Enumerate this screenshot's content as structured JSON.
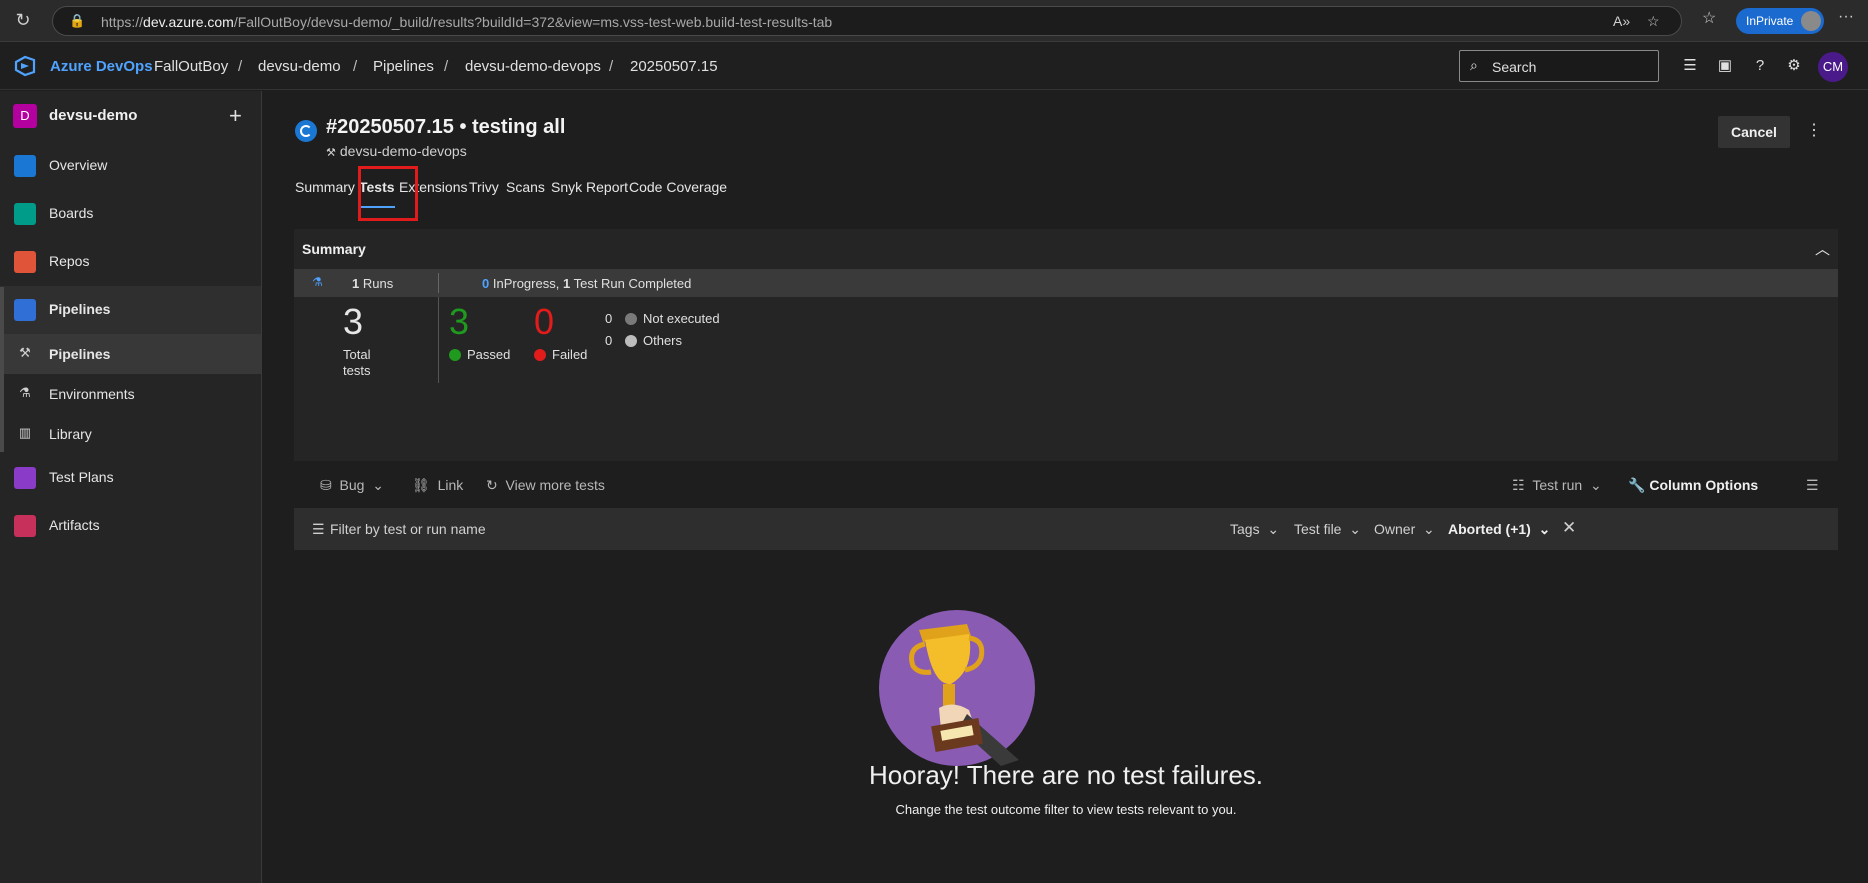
{
  "browser": {
    "url_prefix": "https://",
    "url_host": "dev.azure.com",
    "url_path": "/FallOutBoy/devsu-demo/_build/results?buildId=372&view=ms.vss-test-web.build-test-results-tab",
    "inprivate_label": "InPrivate"
  },
  "header": {
    "brand": "Azure DevOps",
    "breadcrumbs": [
      "FallOutBoy",
      "devsu-demo",
      "Pipelines",
      "devsu-demo-devops",
      "20250507.15"
    ],
    "separator": "/",
    "search_placeholder": "Search",
    "avatar_initials": "CM"
  },
  "sidebar": {
    "project_initial": "D",
    "project_name": "devsu-demo",
    "add_symbol": "+",
    "items": [
      {
        "label": "Overview",
        "color": "#1a78d4"
      },
      {
        "label": "Boards",
        "color": "#009c8a"
      },
      {
        "label": "Repos",
        "color": "#e0553a"
      },
      {
        "label": "Pipelines",
        "color": "#2f6fd6"
      },
      {
        "label": "Test Plans",
        "color": "#8a3cc9"
      },
      {
        "label": "Artifacts",
        "color": "#c6305a"
      }
    ],
    "sub_items": [
      "Pipelines",
      "Environments",
      "Library"
    ]
  },
  "run": {
    "title": "#20250507.15 • testing all",
    "pipeline": "devsu-demo-devops",
    "cancel_label": "Cancel",
    "more_label": "⋮"
  },
  "tabs": [
    "Summary",
    "Tests",
    "Extensions",
    "Trivy",
    "Scans",
    "Snyk Report",
    "Code Coverage"
  ],
  "summary": {
    "title": "Summary",
    "runs_count": "1",
    "runs_label": "Runs",
    "inprogress_count": "0",
    "inprogress_label": "InProgress,",
    "completed_count": "1",
    "completed_label": "Test Run Completed",
    "total": "3",
    "total_label_1": "Total",
    "total_label_2": "tests",
    "passed": "3",
    "passed_label": "Passed",
    "failed": "0",
    "failed_label": "Failed",
    "not_executed": "0",
    "not_executed_label": "Not executed",
    "others": "0",
    "others_label": "Others",
    "colors": {
      "passed": "#1f9a1f",
      "failed": "#e21b1b",
      "not_executed": "#7a7a7a",
      "others": "#bdbdbd"
    }
  },
  "toolbar": {
    "bug": "Bug",
    "link": "Link",
    "view_more": "View more tests",
    "test_run": "Test run",
    "column_options": "Column Options"
  },
  "filter": {
    "placeholder": "Filter by test or run name",
    "tags": "Tags",
    "test_file": "Test file",
    "owner": "Owner",
    "outcome": "Aborted (+1)"
  },
  "empty_state": {
    "title": "Hooray! There are no test failures.",
    "hint": "Change the test outcome filter to view tests relevant to you."
  }
}
